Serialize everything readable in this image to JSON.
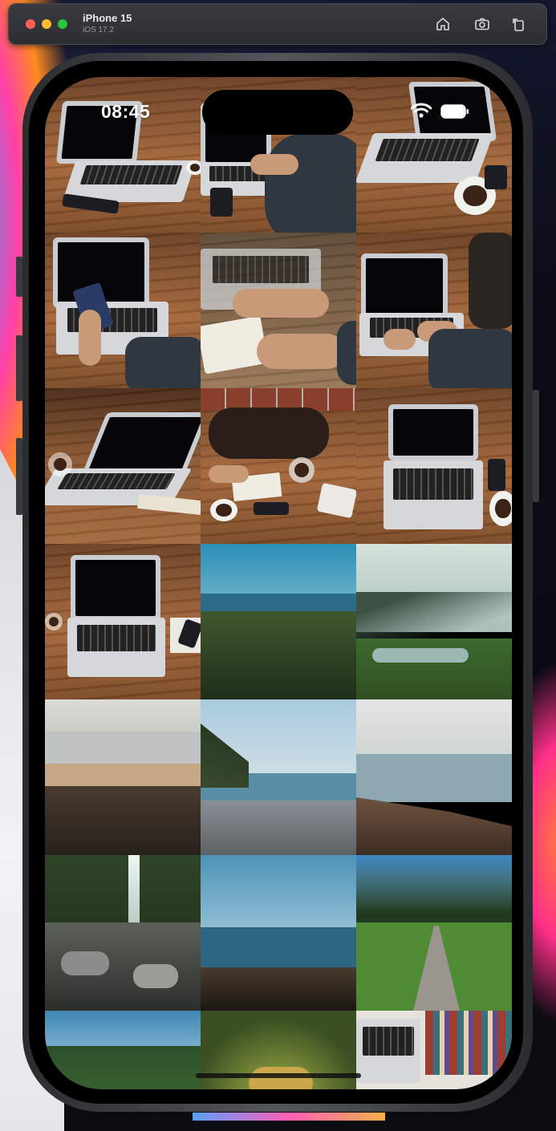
{
  "simulator": {
    "device_name": "iPhone 15",
    "os_version": "iOS 17.2",
    "buttons": [
      {
        "name": "home-button",
        "icon": "home-icon"
      },
      {
        "name": "screenshot-button",
        "icon": "camera-icon"
      },
      {
        "name": "rotate-button",
        "icon": "rotate-icon"
      }
    ]
  },
  "status_bar": {
    "time": "08:45",
    "wifi_icon": "wifi-icon",
    "battery_icon": "battery-icon"
  },
  "gallery": {
    "columns": 3,
    "photos": [
      {
        "subject": "laptop on wooden desk"
      },
      {
        "subject": "person typing on laptop"
      },
      {
        "subject": "laptop with coffee cup"
      },
      {
        "subject": "hands holding phone over laptop"
      },
      {
        "subject": "hands on notebook"
      },
      {
        "subject": "person typing on laptop with watch"
      },
      {
        "subject": "laptop with glass on desk"
      },
      {
        "subject": "desk with bag, notebook and tablet"
      },
      {
        "subject": "laptop top view with phone"
      },
      {
        "subject": "laptop top view with glass"
      },
      {
        "subject": "forest and sea"
      },
      {
        "subject": "river valley with mountains"
      },
      {
        "subject": "beach with rocks"
      },
      {
        "subject": "pebble shore"
      },
      {
        "subject": "rocky coast"
      },
      {
        "subject": "waterfall in forest"
      },
      {
        "subject": "sea with driftwood"
      },
      {
        "subject": "path through park"
      },
      {
        "subject": "grass and trees"
      },
      {
        "subject": "tree canopy"
      },
      {
        "subject": "laptop and bookshelf"
      }
    ]
  }
}
